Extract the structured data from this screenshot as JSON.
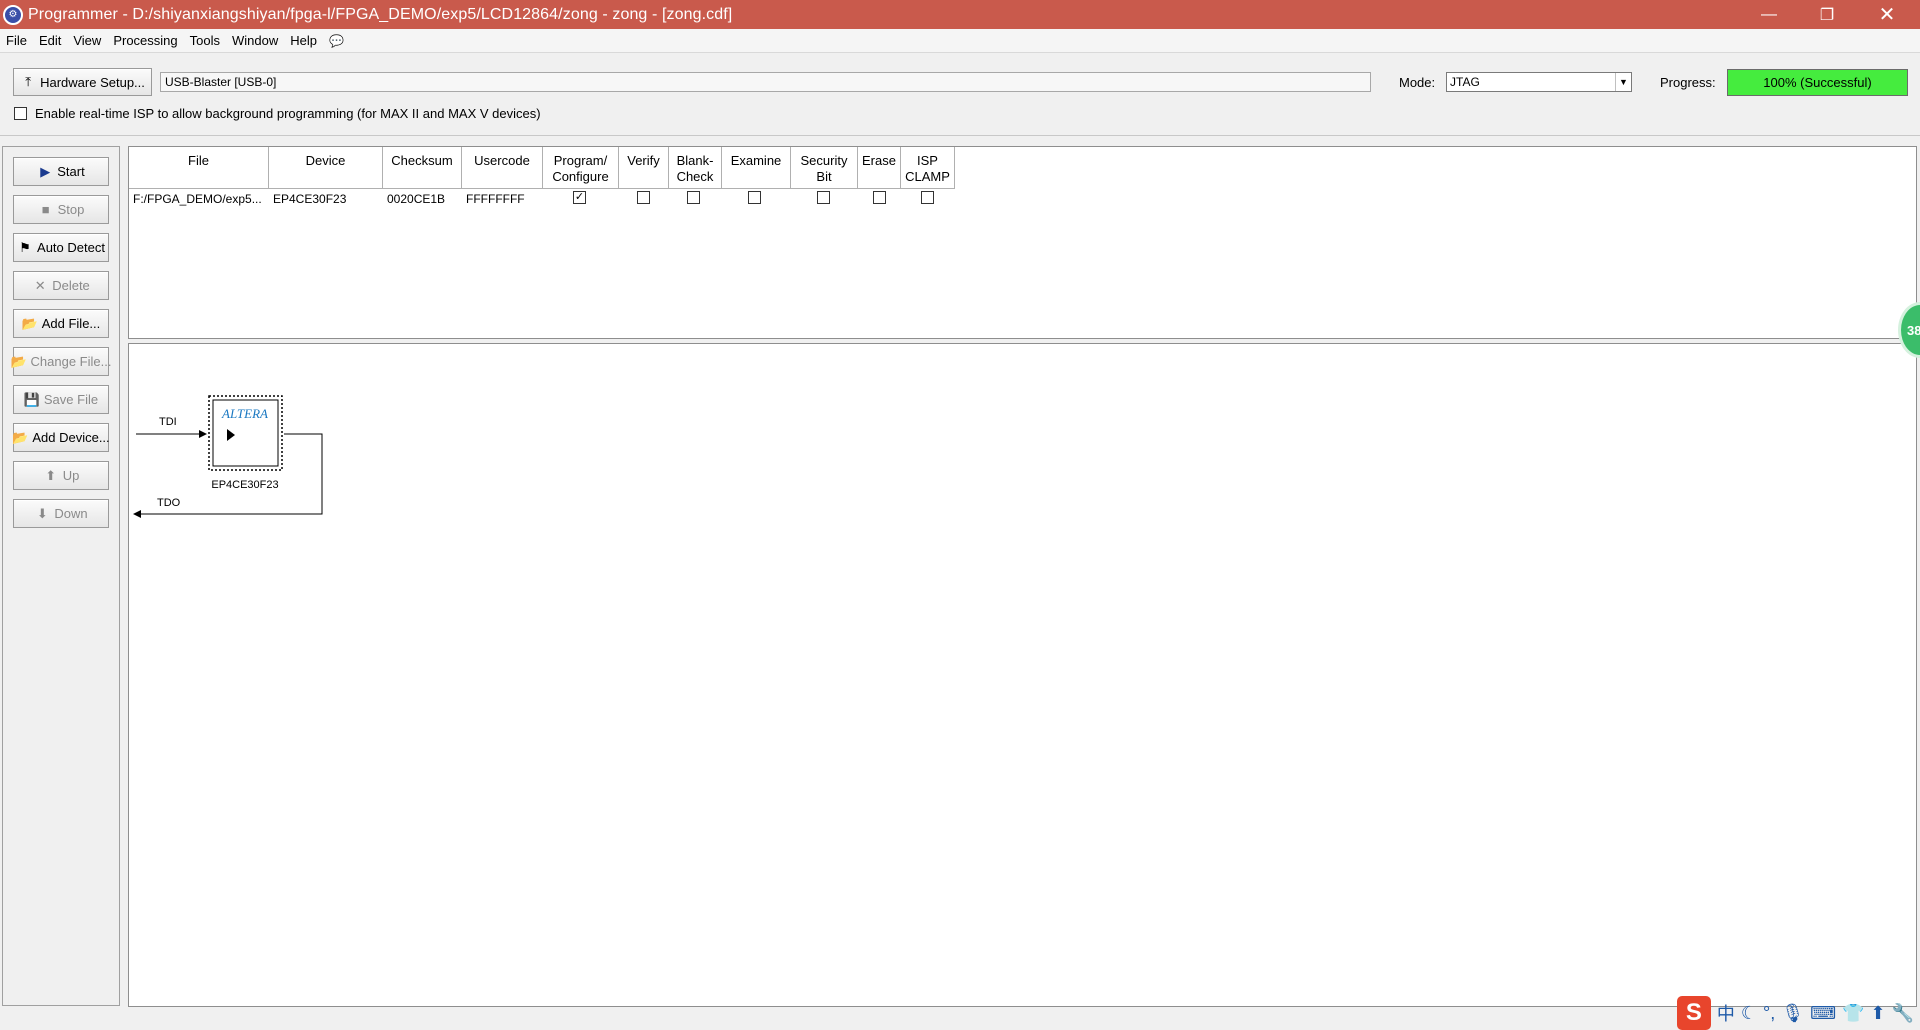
{
  "window": {
    "title": "Programmer - D:/shiyanxiangshiyan/fpga-l/FPGA_DEMO/exp5/LCD12864/zong - zong - [zong.cdf]",
    "controls": [
      "minimize",
      "restore",
      "close"
    ]
  },
  "menu": {
    "items": [
      "File",
      "Edit",
      "View",
      "Processing",
      "Tools",
      "Window",
      "Help"
    ],
    "help_icon": "speech-bubble-icon"
  },
  "toolbar": {
    "hardware_setup_label": "Hardware Setup...",
    "hardware_value": "USB-Blaster [USB-0]",
    "mode_label": "Mode:",
    "mode_value": "JTAG",
    "progress_label": "Progress:",
    "progress_text": "100% (Successful)",
    "progress_percent": 100,
    "progress_color": "#45ec3e",
    "isp_label": "Enable real-time ISP to allow background programming (for MAX II and MAX V devices)",
    "isp_checked": false
  },
  "side_buttons": [
    {
      "label": "Start",
      "icon": "start-icon",
      "enabled": true
    },
    {
      "label": "Stop",
      "icon": "stop-icon",
      "enabled": false
    },
    {
      "label": "Auto Detect",
      "icon": "auto-detect-icon",
      "enabled": true
    },
    {
      "label": "Delete",
      "icon": "delete-icon",
      "enabled": false
    },
    {
      "label": "Add File...",
      "icon": "add-file-icon",
      "enabled": true
    },
    {
      "label": "Change File...",
      "icon": "change-file-icon",
      "enabled": false
    },
    {
      "label": "Save File",
      "icon": "save-file-icon",
      "enabled": false
    },
    {
      "label": "Add Device...",
      "icon": "add-device-icon",
      "enabled": true
    },
    {
      "label": "Up",
      "icon": "up-arrow-icon",
      "enabled": false
    },
    {
      "label": "Down",
      "icon": "down-arrow-icon",
      "enabled": false
    }
  ],
  "table": {
    "headers": [
      "File",
      "Device",
      "Checksum",
      "Usercode",
      "Program/\nConfigure",
      "Verify",
      "Blank-\nCheck",
      "Examine",
      "Security\nBit",
      "Erase",
      "ISP\nCLAMP"
    ],
    "rows": [
      {
        "file": "F:/FPGA_DEMO/exp5...",
        "device": "EP4CE30F23",
        "checksum": "0020CE1B",
        "usercode": "FFFFFFFF",
        "checks": [
          true,
          false,
          false,
          false,
          false,
          false,
          false
        ]
      }
    ]
  },
  "chain": {
    "tdi_label": "TDI",
    "tdo_label": "TDO",
    "chip_logo": "ALTERA",
    "device_name": "EP4CE30F23"
  },
  "overlay": {
    "float_ball_text": "38"
  },
  "tray": {
    "ime_char": "中"
  }
}
